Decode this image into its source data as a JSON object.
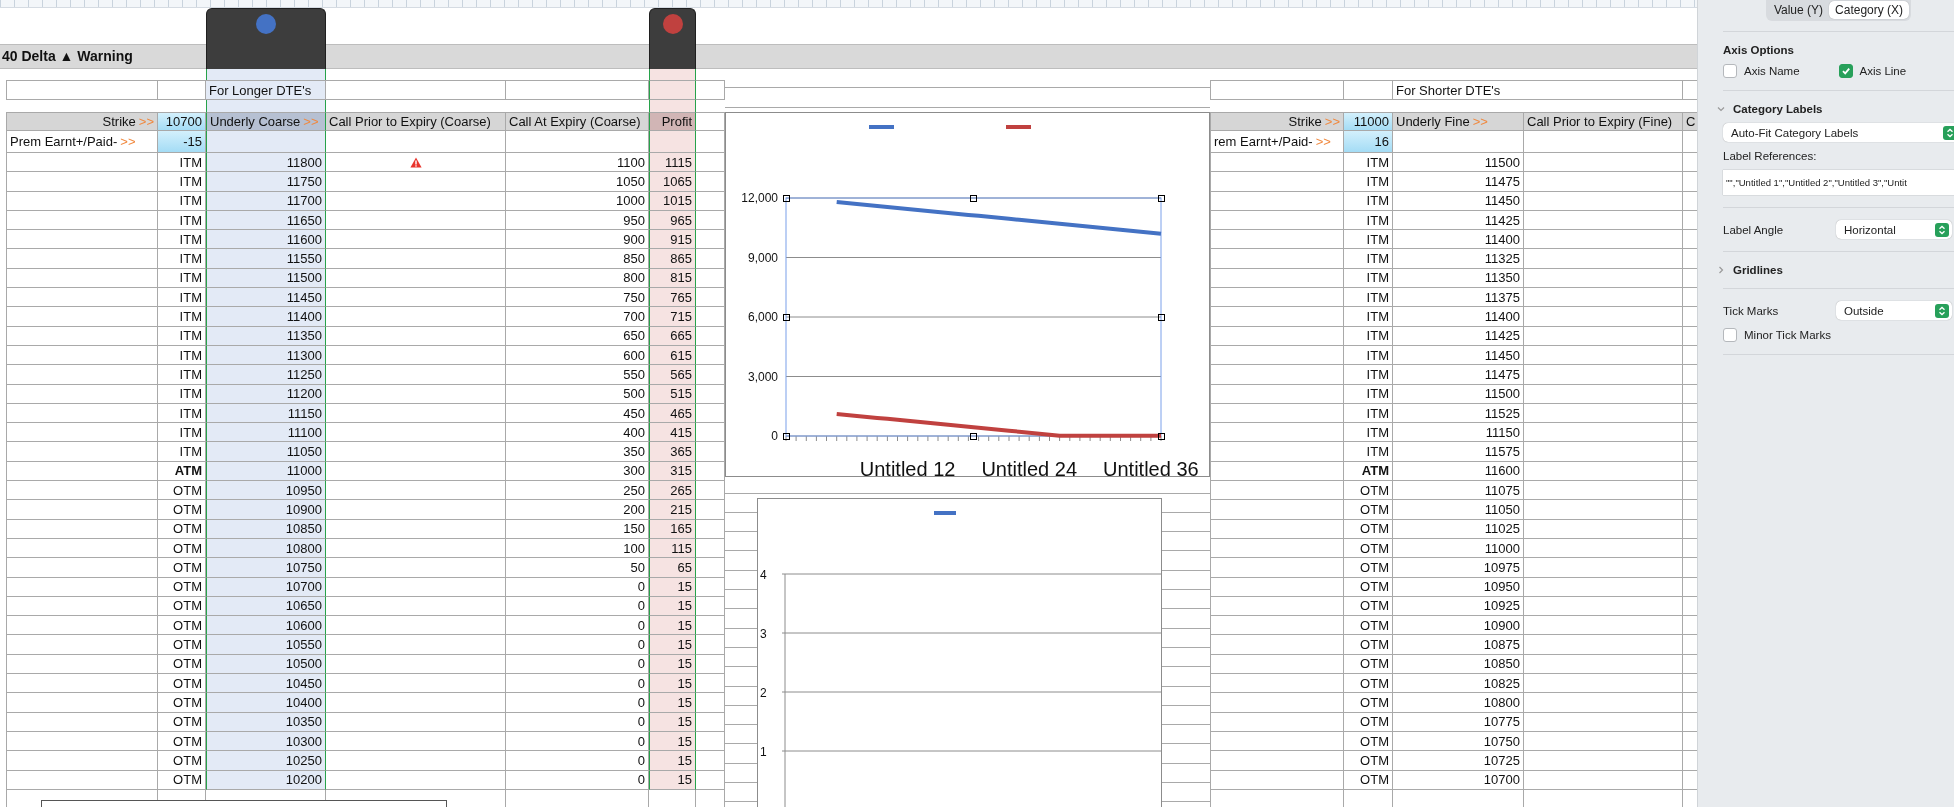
{
  "title_bar": "40 Delta ▲ Warning",
  "left_table": {
    "banner": "For Longer DTE's",
    "strike_label": "Strike",
    "strike_arrow": ">>",
    "strike_value": "10700",
    "prem_label": "Prem Earnt+/Paid-",
    "prem_arrow": ">>",
    "prem_value": "-15",
    "columns": [
      {
        "kind": "underlying",
        "label": "Underly Coarse",
        "arrow": ">>",
        "selected": true,
        "color": "#4472c4"
      },
      {
        "kind": "call_prior",
        "label": "Call Prior to Expiry (Coarse)",
        "selected": false
      },
      {
        "kind": "call_expiry",
        "label": "Call At Expiry (Coarse)",
        "selected": false
      },
      {
        "kind": "profit",
        "label": "Profit",
        "selected": true,
        "color": "#c0413f"
      }
    ],
    "rows": [
      {
        "status": "ITM",
        "bold": false,
        "underlying": "11800",
        "warning": true,
        "call_at_expiry": "1100",
        "profit": "1115"
      },
      {
        "status": "ITM",
        "bold": false,
        "underlying": "11750",
        "warning": false,
        "call_at_expiry": "1050",
        "profit": "1065"
      },
      {
        "status": "ITM",
        "bold": false,
        "underlying": "11700",
        "warning": false,
        "call_at_expiry": "1000",
        "profit": "1015"
      },
      {
        "status": "ITM",
        "bold": false,
        "underlying": "11650",
        "warning": false,
        "call_at_expiry": "950",
        "profit": "965"
      },
      {
        "status": "ITM",
        "bold": false,
        "underlying": "11600",
        "warning": false,
        "call_at_expiry": "900",
        "profit": "915"
      },
      {
        "status": "ITM",
        "bold": false,
        "underlying": "11550",
        "warning": false,
        "call_at_expiry": "850",
        "profit": "865"
      },
      {
        "status": "ITM",
        "bold": false,
        "underlying": "11500",
        "warning": false,
        "call_at_expiry": "800",
        "profit": "815"
      },
      {
        "status": "ITM",
        "bold": false,
        "underlying": "11450",
        "warning": false,
        "call_at_expiry": "750",
        "profit": "765"
      },
      {
        "status": "ITM",
        "bold": false,
        "underlying": "11400",
        "warning": false,
        "call_at_expiry": "700",
        "profit": "715"
      },
      {
        "status": "ITM",
        "bold": false,
        "underlying": "11350",
        "warning": false,
        "call_at_expiry": "650",
        "profit": "665"
      },
      {
        "status": "ITM",
        "bold": false,
        "underlying": "11300",
        "warning": false,
        "call_at_expiry": "600",
        "profit": "615"
      },
      {
        "status": "ITM",
        "bold": false,
        "underlying": "11250",
        "warning": false,
        "call_at_expiry": "550",
        "profit": "565"
      },
      {
        "status": "ITM",
        "bold": false,
        "underlying": "11200",
        "warning": false,
        "call_at_expiry": "500",
        "profit": "515"
      },
      {
        "status": "ITM",
        "bold": false,
        "underlying": "11150",
        "warning": false,
        "call_at_expiry": "450",
        "profit": "465"
      },
      {
        "status": "ITM",
        "bold": false,
        "underlying": "11100",
        "warning": false,
        "call_at_expiry": "400",
        "profit": "415"
      },
      {
        "status": "ITM",
        "bold": false,
        "underlying": "11050",
        "warning": false,
        "call_at_expiry": "350",
        "profit": "365"
      },
      {
        "status": "ATM",
        "bold": true,
        "underlying": "11000",
        "warning": false,
        "call_at_expiry": "300",
        "profit": "315"
      },
      {
        "status": "OTM",
        "bold": false,
        "underlying": "10950",
        "warning": false,
        "call_at_expiry": "250",
        "profit": "265"
      },
      {
        "status": "OTM",
        "bold": false,
        "underlying": "10900",
        "warning": false,
        "call_at_expiry": "200",
        "profit": "215"
      },
      {
        "status": "OTM",
        "bold": false,
        "underlying": "10850",
        "warning": false,
        "call_at_expiry": "150",
        "profit": "165"
      },
      {
        "status": "OTM",
        "bold": false,
        "underlying": "10800",
        "warning": false,
        "call_at_expiry": "100",
        "profit": "115"
      },
      {
        "status": "OTM",
        "bold": false,
        "underlying": "10750",
        "warning": false,
        "call_at_expiry": "50",
        "profit": "65"
      },
      {
        "status": "OTM",
        "bold": false,
        "underlying": "10700",
        "warning": false,
        "call_at_expiry": "0",
        "profit": "15"
      },
      {
        "status": "OTM",
        "bold": false,
        "underlying": "10650",
        "warning": false,
        "call_at_expiry": "0",
        "profit": "15"
      },
      {
        "status": "OTM",
        "bold": false,
        "underlying": "10600",
        "warning": false,
        "call_at_expiry": "0",
        "profit": "15"
      },
      {
        "status": "OTM",
        "bold": false,
        "underlying": "10550",
        "warning": false,
        "call_at_expiry": "0",
        "profit": "15"
      },
      {
        "status": "OTM",
        "bold": false,
        "underlying": "10500",
        "warning": false,
        "call_at_expiry": "0",
        "profit": "15"
      },
      {
        "status": "OTM",
        "bold": false,
        "underlying": "10450",
        "warning": false,
        "call_at_expiry": "0",
        "profit": "15"
      },
      {
        "status": "OTM",
        "bold": false,
        "underlying": "10400",
        "warning": false,
        "call_at_expiry": "0",
        "profit": "15"
      },
      {
        "status": "OTM",
        "bold": false,
        "underlying": "10350",
        "warning": false,
        "call_at_expiry": "0",
        "profit": "15"
      },
      {
        "status": "OTM",
        "bold": false,
        "underlying": "10300",
        "warning": false,
        "call_at_expiry": "0",
        "profit": "15"
      },
      {
        "status": "OTM",
        "bold": false,
        "underlying": "10250",
        "warning": false,
        "call_at_expiry": "0",
        "profit": "15"
      },
      {
        "status": "OTM",
        "bold": false,
        "underlying": "10200",
        "warning": false,
        "call_at_expiry": "0",
        "profit": "15"
      }
    ]
  },
  "charts": [
    {
      "chart_data": {
        "type": "line",
        "grid": true,
        "categories": [
          null,
          null,
          null,
          null,
          null,
          null,
          null,
          null,
          null,
          null,
          null,
          null,
          "Untitled 12",
          null,
          null,
          null,
          null,
          null,
          null,
          null,
          null,
          null,
          null,
          null,
          "Untitled 24",
          null,
          null,
          null,
          null,
          null,
          null,
          null,
          null,
          null,
          null,
          null,
          "Untitled 36",
          null
        ],
        "ylim": [
          0,
          12000
        ],
        "yticks": [
          {
            "value": 0,
            "label": "0"
          },
          {
            "value": 3000,
            "label": "3,000"
          },
          {
            "value": 6000,
            "label": "6,000"
          },
          {
            "value": 9000,
            "label": "9,000"
          },
          {
            "value": 12000,
            "label": "12,000"
          }
        ],
        "series": [
          {
            "color": "#4472c4",
            "values": [
              null,
              null,
              null,
              null,
              null,
              11800,
              11750,
              11700,
              11650,
              11600,
              11550,
              11500,
              11450,
              11400,
              11350,
              11300,
              11250,
              11200,
              11150,
              11100,
              11050,
              11000,
              10950,
              10900,
              10850,
              10800,
              10750,
              10700,
              10650,
              10600,
              10550,
              10500,
              10450,
              10400,
              10350,
              10300,
              10250,
              10200
            ]
          },
          {
            "color": "#c0413f",
            "values": [
              null,
              null,
              null,
              null,
              null,
              1115,
              1065,
              1015,
              965,
              915,
              865,
              815,
              765,
              715,
              665,
              615,
              565,
              515,
              465,
              415,
              365,
              315,
              265,
              215,
              165,
              115,
              65,
              15,
              15,
              15,
              15,
              15,
              15,
              15,
              15,
              15,
              15,
              15
            ]
          }
        ]
      }
    },
    {
      "chart_data": {
        "type": "line",
        "grid": true,
        "ylim": [
          0,
          4
        ],
        "yticks": [
          1,
          2,
          3,
          4
        ],
        "series": [
          {
            "color": "#4472c4"
          }
        ]
      }
    }
  ],
  "right_table": {
    "banner": "For Shorter DTE's",
    "strike_label": "Strike",
    "strike_arrow": ">>",
    "strike_value": "11000",
    "prem_label": "rem Earnt+/Paid-",
    "prem_arrow": ">>",
    "prem_value": "16",
    "columns": [
      {
        "kind": "underlying",
        "label": "Underly Fine",
        "arrow": ">>",
        "selected": false
      },
      {
        "kind": "call_prior",
        "label": "Call Prior to Expiry (Fine)",
        "selected": false
      },
      {
        "kind": "other",
        "label": "C",
        "selected": false
      }
    ],
    "rows": [
      {
        "status": "ITM",
        "bold": false,
        "underlying": "11500"
      },
      {
        "status": "ITM",
        "bold": false,
        "underlying": "11475"
      },
      {
        "status": "ITM",
        "bold": false,
        "underlying": "11450"
      },
      {
        "status": "ITM",
        "bold": false,
        "underlying": "11425"
      },
      {
        "status": "ITM",
        "bold": false,
        "underlying": "11400"
      },
      {
        "status": "ITM",
        "bold": false,
        "underlying": "11325"
      },
      {
        "status": "ITM",
        "bold": false,
        "underlying": "11350"
      },
      {
        "status": "ITM",
        "bold": false,
        "underlying": "11375"
      },
      {
        "status": "ITM",
        "bold": false,
        "underlying": "11400"
      },
      {
        "status": "ITM",
        "bold": false,
        "underlying": "11425"
      },
      {
        "status": "ITM",
        "bold": false,
        "underlying": "11450"
      },
      {
        "status": "ITM",
        "bold": false,
        "underlying": "11475"
      },
      {
        "status": "ITM",
        "bold": false,
        "underlying": "11500"
      },
      {
        "status": "ITM",
        "bold": false,
        "underlying": "11525"
      },
      {
        "status": "ITM",
        "bold": false,
        "underlying": "11150"
      },
      {
        "status": "ITM",
        "bold": false,
        "underlying": "11575"
      },
      {
        "status": "ATM",
        "bold": true,
        "underlying": "11600"
      },
      {
        "status": "OTM",
        "bold": false,
        "underlying": "11075"
      },
      {
        "status": "OTM",
        "bold": false,
        "underlying": "11050"
      },
      {
        "status": "OTM",
        "bold": false,
        "underlying": "11025"
      },
      {
        "status": "OTM",
        "bold": false,
        "underlying": "11000"
      },
      {
        "status": "OTM",
        "bold": false,
        "underlying": "10975"
      },
      {
        "status": "OTM",
        "bold": false,
        "underlying": "10950"
      },
      {
        "status": "OTM",
        "bold": false,
        "underlying": "10925"
      },
      {
        "status": "OTM",
        "bold": false,
        "underlying": "10900"
      },
      {
        "status": "OTM",
        "bold": false,
        "underlying": "10875"
      },
      {
        "status": "OTM",
        "bold": false,
        "underlying": "10850"
      },
      {
        "status": "OTM",
        "bold": false,
        "underlying": "10825"
      },
      {
        "status": "OTM",
        "bold": false,
        "underlying": "10800"
      },
      {
        "status": "OTM",
        "bold": false,
        "underlying": "10775"
      },
      {
        "status": "OTM",
        "bold": false,
        "underlying": "10750"
      },
      {
        "status": "OTM",
        "bold": false,
        "underlying": "10725"
      },
      {
        "status": "OTM",
        "bold": false,
        "underlying": "10700"
      }
    ]
  },
  "inspector": {
    "tabs": [
      {
        "label": "Value (Y)",
        "selected": false
      },
      {
        "label": "Category (X)",
        "selected": true
      }
    ],
    "sections": [
      {
        "items": [
          {
            "kind": "heading",
            "label": "Axis Options"
          },
          {
            "kind": "checkboxes",
            "checkboxes": [
              {
                "label": "Axis Name",
                "checked": false
              },
              {
                "label": "Axis Line",
                "checked": true
              }
            ]
          }
        ]
      },
      {
        "items": [
          {
            "kind": "disclosure",
            "label": "Category Labels",
            "expanded": true
          },
          {
            "kind": "popup",
            "value": "Auto-Fit Category Labels"
          },
          {
            "kind": "caption",
            "label": "Label References:"
          },
          {
            "kind": "field",
            "value": "\"\",\"Untitled 1\",\"Untitled 2\",\"Untitled 3\",\"Untit"
          }
        ]
      },
      {
        "items": [
          {
            "kind": "labeled_popup",
            "label": "Label Angle",
            "value": "Horizontal"
          }
        ]
      },
      {
        "items": [
          {
            "kind": "disclosure",
            "label": "Gridlines",
            "expanded": false
          }
        ]
      },
      {
        "items": [
          {
            "kind": "labeled_popup",
            "label": "Tick Marks",
            "value": "Outside"
          },
          {
            "kind": "checkboxes",
            "checkboxes": [
              {
                "label": "Minor Tick Marks",
                "checked": false
              }
            ]
          }
        ]
      }
    ]
  }
}
